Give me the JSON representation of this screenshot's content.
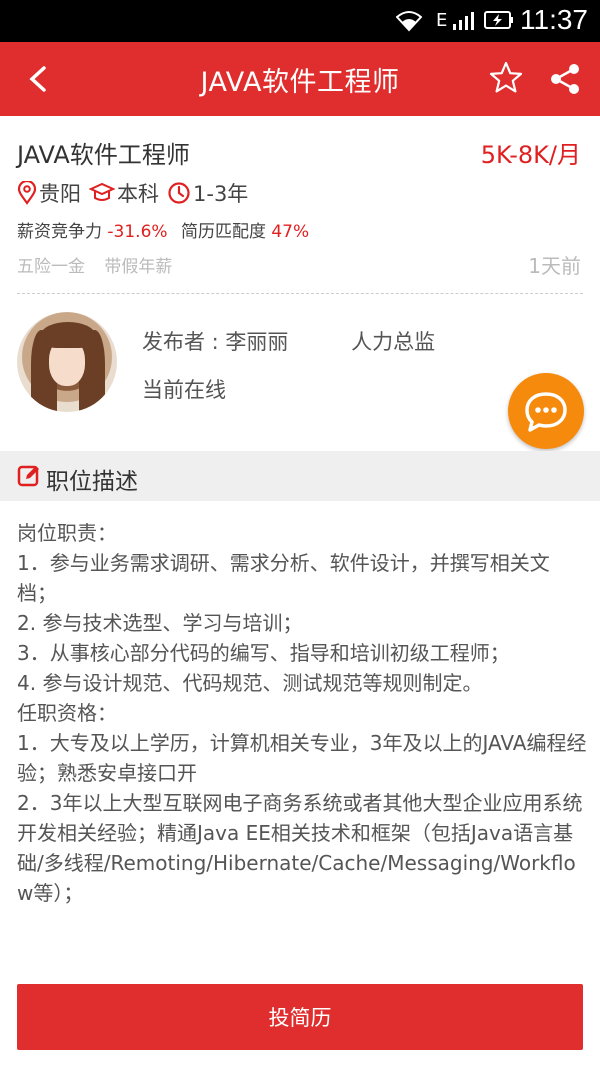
{
  "status_bar": {
    "time": "11:37",
    "network": "E",
    "icons": [
      "wifi-icon",
      "signal-icon",
      "battery-icon"
    ]
  },
  "app_bar": {
    "title": "JAVA软件工程师",
    "icons": [
      "back-arrow-icon",
      "star-icon",
      "share-icon"
    ]
  },
  "job": {
    "title": "JAVA软件工程师",
    "salary": "5K-8K/月",
    "location": "贵阳",
    "education": "本科",
    "experience": "1-3年",
    "salary_competitiveness_label": "薪资竞争力",
    "salary_competitiveness_value": "-31.6%",
    "resume_match_label": "简历匹配度",
    "resume_match_value": "47%",
    "benefits": [
      "五险一金",
      "带假年薪"
    ],
    "posted": "1天前"
  },
  "poster": {
    "label": "发布者 : 李丽丽",
    "role": "人力总监",
    "status": "当前在线"
  },
  "section": {
    "title": "职位描述"
  },
  "description": [
    "岗位职责：",
    "1．参与业务需求调研、需求分析、软件设计，并撰写相关文档；",
    "2. 参与技术选型、学习与培训；",
    "3．从事核心部分代码的编写、指导和培训初级工程师；",
    "4. 参与设计规范、代码规范、测试规范等规则制定。",
    "任职资格：",
    "1．大专及以上学历，计算机相关专业，3年及以上的JAVA编程经验；熟悉安卓接口开",
    "2．3年以上大型互联网电子商务系统或者其他大型企业应用系统开发相关经验；精通Java EE相关技术和框架（包括Java语言基础/多线程/Remoting/Hibernate/Cache/Messaging/Workflow等）；"
  ],
  "apply_button": "投简历",
  "colors": {
    "primary": "#e02e2e",
    "accent_orange": "#f58a0c",
    "salary_red": "#e02020"
  }
}
